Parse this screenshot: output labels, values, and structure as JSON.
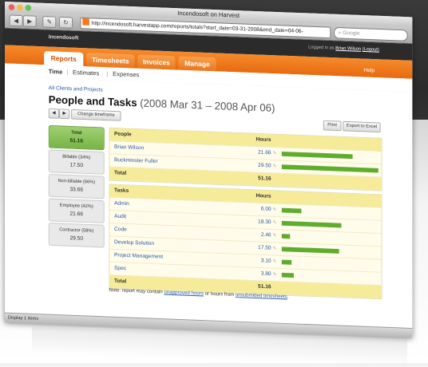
{
  "window": {
    "title": "Incendosoft on Harvest"
  },
  "toolbar": {
    "url": "http://incendosoft.harvestapp.com/reports/totals?start_date=03-31-2008&end_date=04-06-",
    "search_placeholder": "Google"
  },
  "header": {
    "company": "Incendosoft",
    "logged_in_prefix": "Logged in as ",
    "user": "Brian Wilson",
    "logout": "(Logout)"
  },
  "nav": {
    "tabs": [
      "Reports",
      "Timesheets",
      "Invoices",
      "Manage"
    ],
    "help": "Help"
  },
  "subnav": {
    "items": [
      "Time",
      "Estimates",
      "Expenses"
    ]
  },
  "page": {
    "breadcrumb": "All Clients and Projects",
    "title": "People and Tasks",
    "date_range": "(2008 Mar 31 – 2008 Apr 06)",
    "prev": "◀",
    "next": "▶",
    "change_timeframe": "Change timeframe",
    "print": "Print",
    "export": "Export to Excel"
  },
  "summary": [
    {
      "label": "Total",
      "value": "51.16"
    },
    {
      "label": "Billable (34%)",
      "value": "17.50"
    },
    {
      "label": "Non-billable (66%)",
      "value": "33.66"
    },
    {
      "label": "Employee (42%)",
      "value": "21.66"
    },
    {
      "label": "Contractor (58%)",
      "value": "29.50"
    }
  ],
  "people_table": {
    "header_name": "People",
    "header_hours": "Hours",
    "rows": [
      {
        "name": "Brian Wilson",
        "hours": "21.66",
        "value": 21.66
      },
      {
        "name": "Buckminster Fuller",
        "hours": "29.50",
        "value": 29.5
      }
    ],
    "total_label": "Total",
    "total_hours": "51.16"
  },
  "tasks_table": {
    "header_name": "Tasks",
    "header_hours": "Hours",
    "rows": [
      {
        "name": "Admin",
        "hours": "6.00",
        "value": 6.0
      },
      {
        "name": "Audit",
        "hours": "18.30",
        "value": 18.3
      },
      {
        "name": "Code",
        "hours": "2.46",
        "value": 2.46
      },
      {
        "name": "Develop Solution",
        "hours": "17.50",
        "value": 17.5
      },
      {
        "name": "Project Management",
        "hours": "3.10",
        "value": 3.1
      },
      {
        "name": "Spec",
        "hours": "3.80",
        "value": 3.8
      }
    ],
    "total_label": "Total",
    "total_hours": "51.16"
  },
  "note": {
    "prefix": "Note: report may contain ",
    "link1": "unapproved hours",
    "middle": " or hours from ",
    "link2": "unsubmitted timesheets",
    "suffix": "."
  },
  "statusbar": {
    "text": "Display 1 items"
  },
  "colors": {
    "accent": "#f47920",
    "bar": "#5fad2f",
    "total_active": "#8ac35a"
  }
}
